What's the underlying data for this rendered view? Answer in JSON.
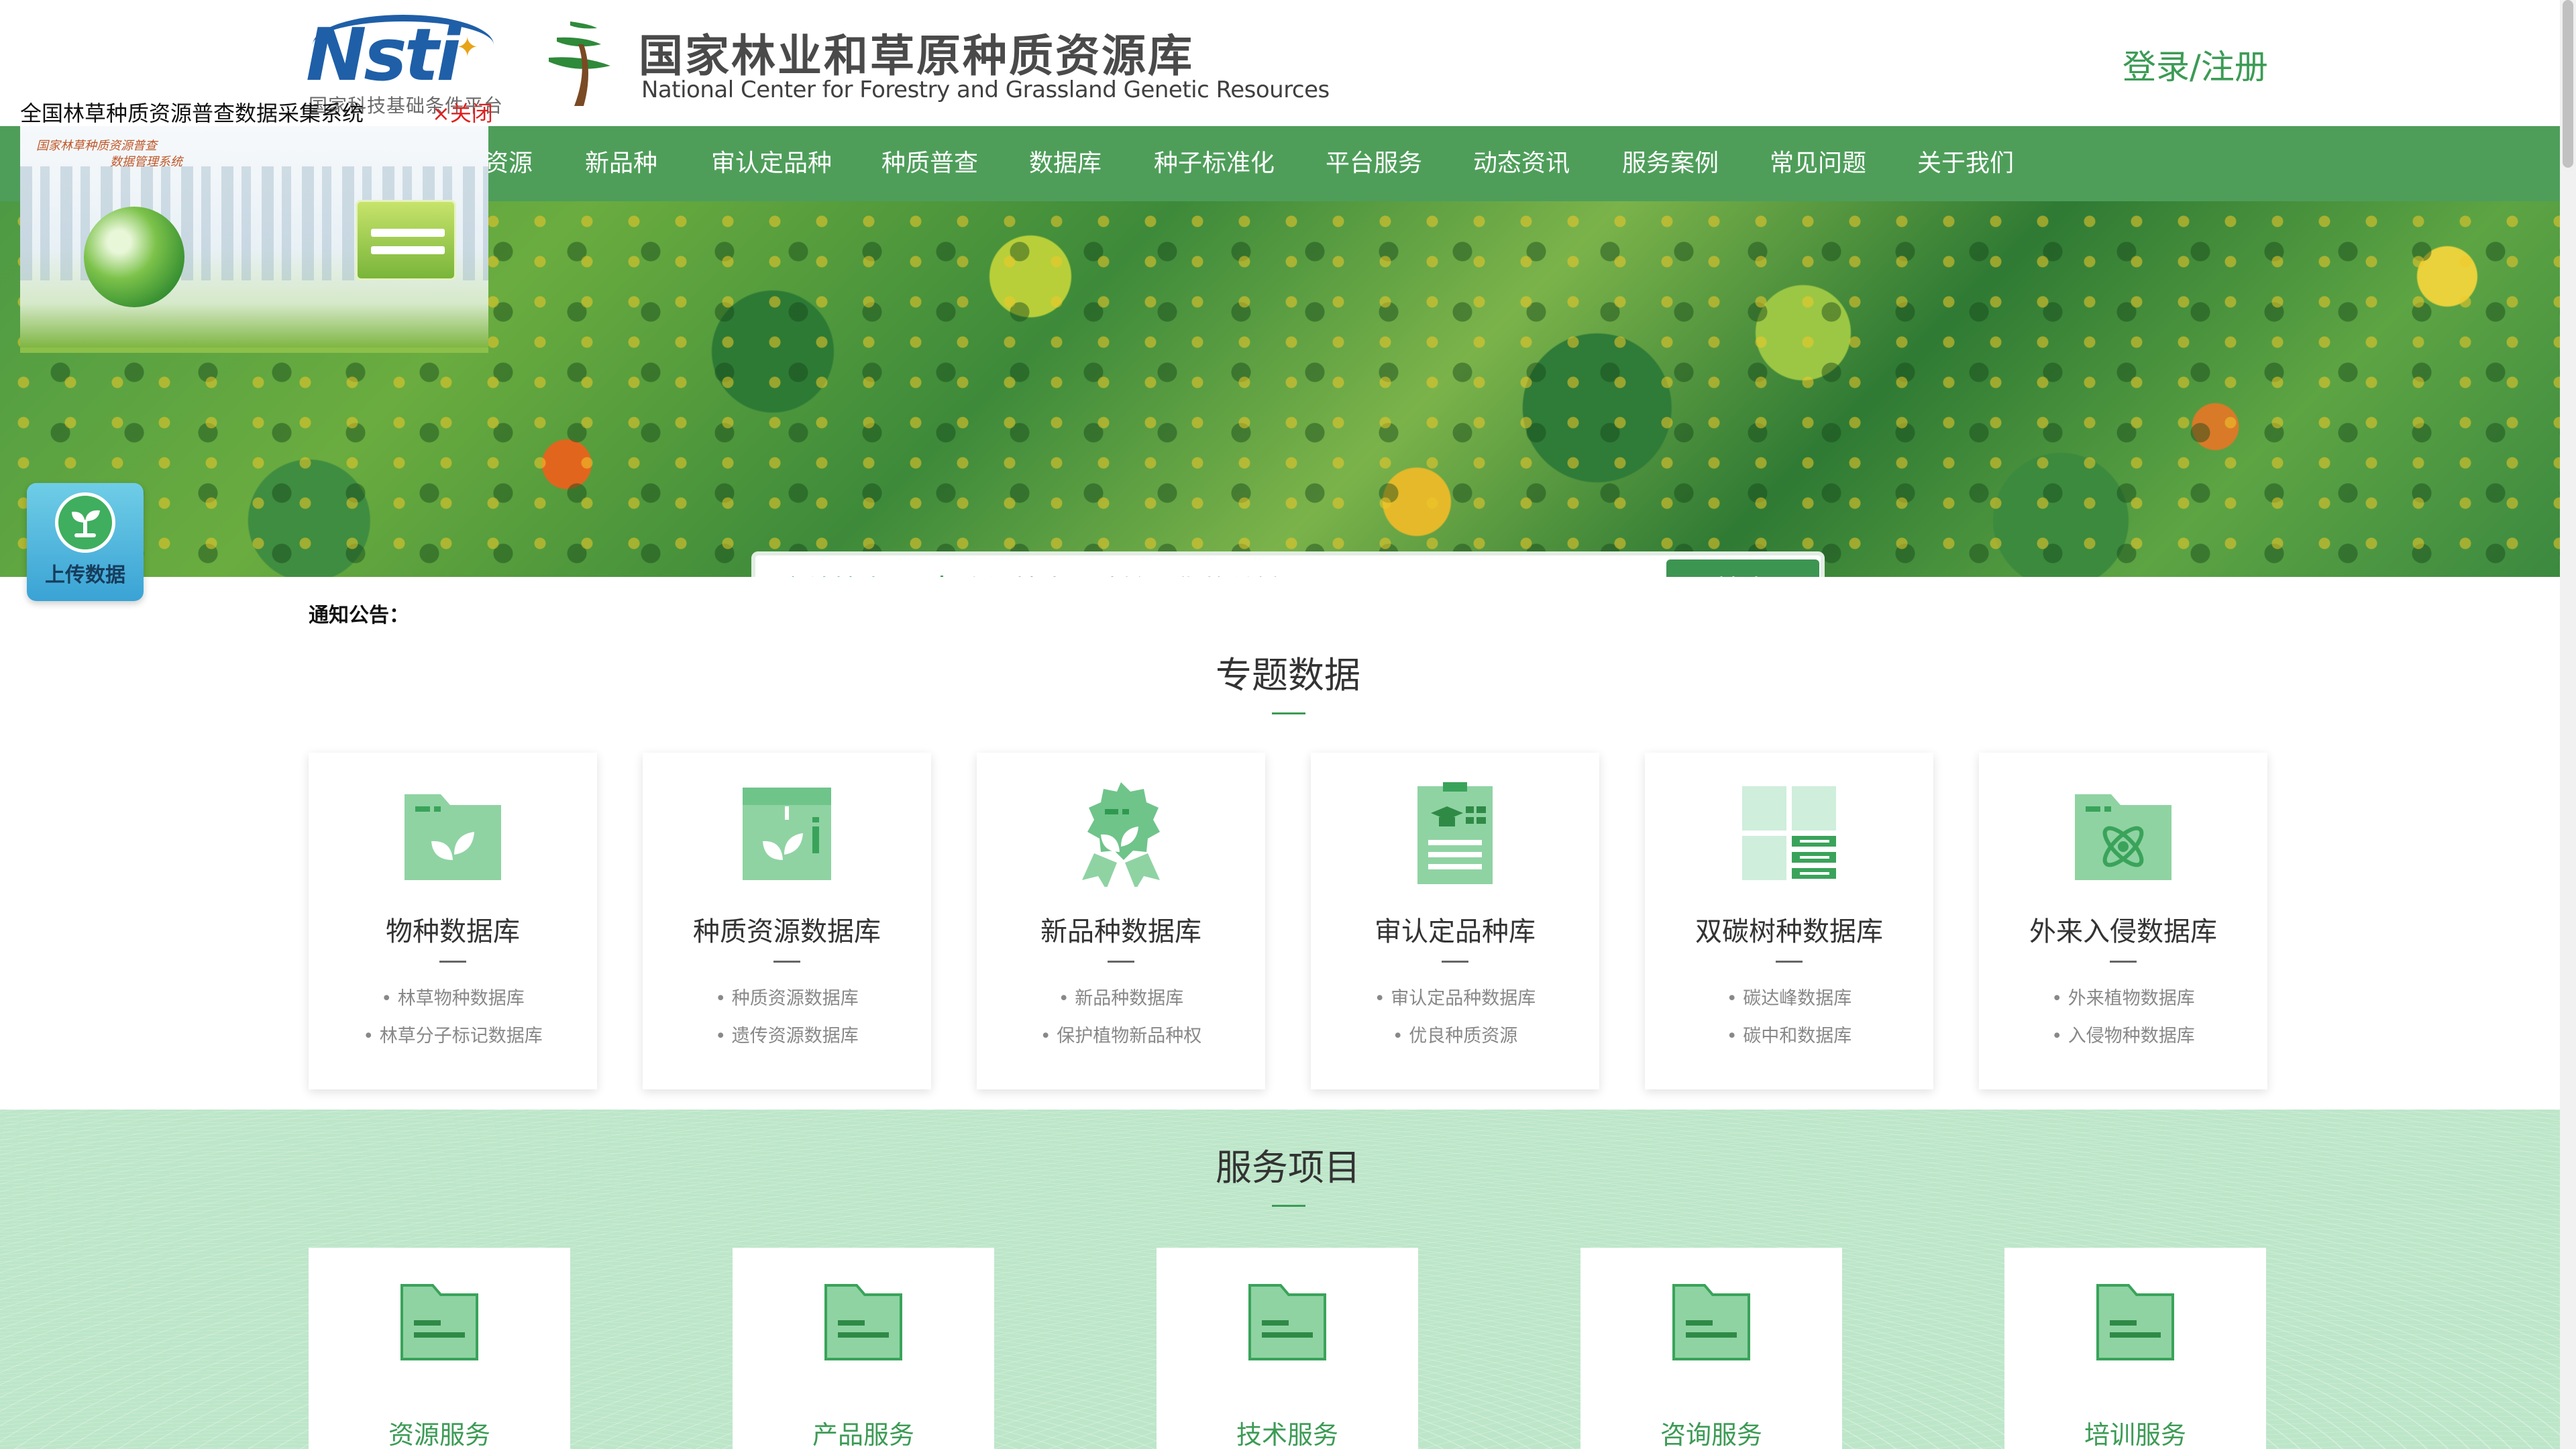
{
  "header": {
    "nsti_logo_text": "Nsti",
    "nsti_subtitle": "国家科技基础条件平台",
    "site_title_cn": "国家林业和草原种质资源库",
    "site_title_en": "National Center for Forestry and Grassland Genetic Resources",
    "login_label": "登录/注册"
  },
  "nav": {
    "items": [
      "资源",
      "新品种",
      "审认定品种",
      "种质普查",
      "数据库",
      "种子标准化",
      "平台服务",
      "动态资讯",
      "服务案例",
      "常见问题",
      "关于我们"
    ]
  },
  "search": {
    "scope_label": "全站搜索",
    "placeholder": "资源搜索，请输入您的关键词",
    "button_label": "搜索"
  },
  "popup": {
    "title": "全国林草种质资源普查数据采集系统",
    "close_label": "×关闭",
    "image_caption_line1": "国家林草种质资源普查",
    "image_caption_line2": "数据管理系统"
  },
  "upload": {
    "label": "上传数据"
  },
  "notice": {
    "label": "通知公告："
  },
  "topics": {
    "title": "专题数据",
    "cards": [
      {
        "title": "物种数据库",
        "links": [
          "林草物种数据库",
          "林草分子标记数据库"
        ],
        "icon": "folder-leaf-icon"
      },
      {
        "title": "种质资源数据库",
        "links": [
          "种质资源数据库",
          "遗传资源数据库"
        ],
        "icon": "box-leaf-icon"
      },
      {
        "title": "新品种数据库",
        "links": [
          "新品种数据库",
          "保护植物新品种权"
        ],
        "icon": "badge-leaf-icon"
      },
      {
        "title": "审认定品种库",
        "links": [
          "审认定品种数据库",
          "优良种质资源"
        ],
        "icon": "certificate-icon"
      },
      {
        "title": "双碳树种数据库",
        "links": [
          "碳达峰数据库",
          "碳中和数据库"
        ],
        "icon": "grid-panel-icon"
      },
      {
        "title": "外来入侵数据库",
        "links": [
          "外来植物数据库",
          "入侵物种数据库"
        ],
        "icon": "folder-atom-icon"
      }
    ]
  },
  "services": {
    "title": "服务项目",
    "items": [
      {
        "label": "资源服务",
        "icon": "folder-icon"
      },
      {
        "label": "产品服务",
        "icon": "folder-icon"
      },
      {
        "label": "技术服务",
        "icon": "folder-icon"
      },
      {
        "label": "咨询服务",
        "icon": "folder-icon"
      },
      {
        "label": "培训服务",
        "icon": "folder-icon"
      }
    ]
  },
  "colors": {
    "brand_green": "#4e9e5a",
    "accent_green": "#3c9b55",
    "icon_green": "#7ccc92",
    "services_bg": "#bde6c9",
    "close_red": "#e02020"
  }
}
